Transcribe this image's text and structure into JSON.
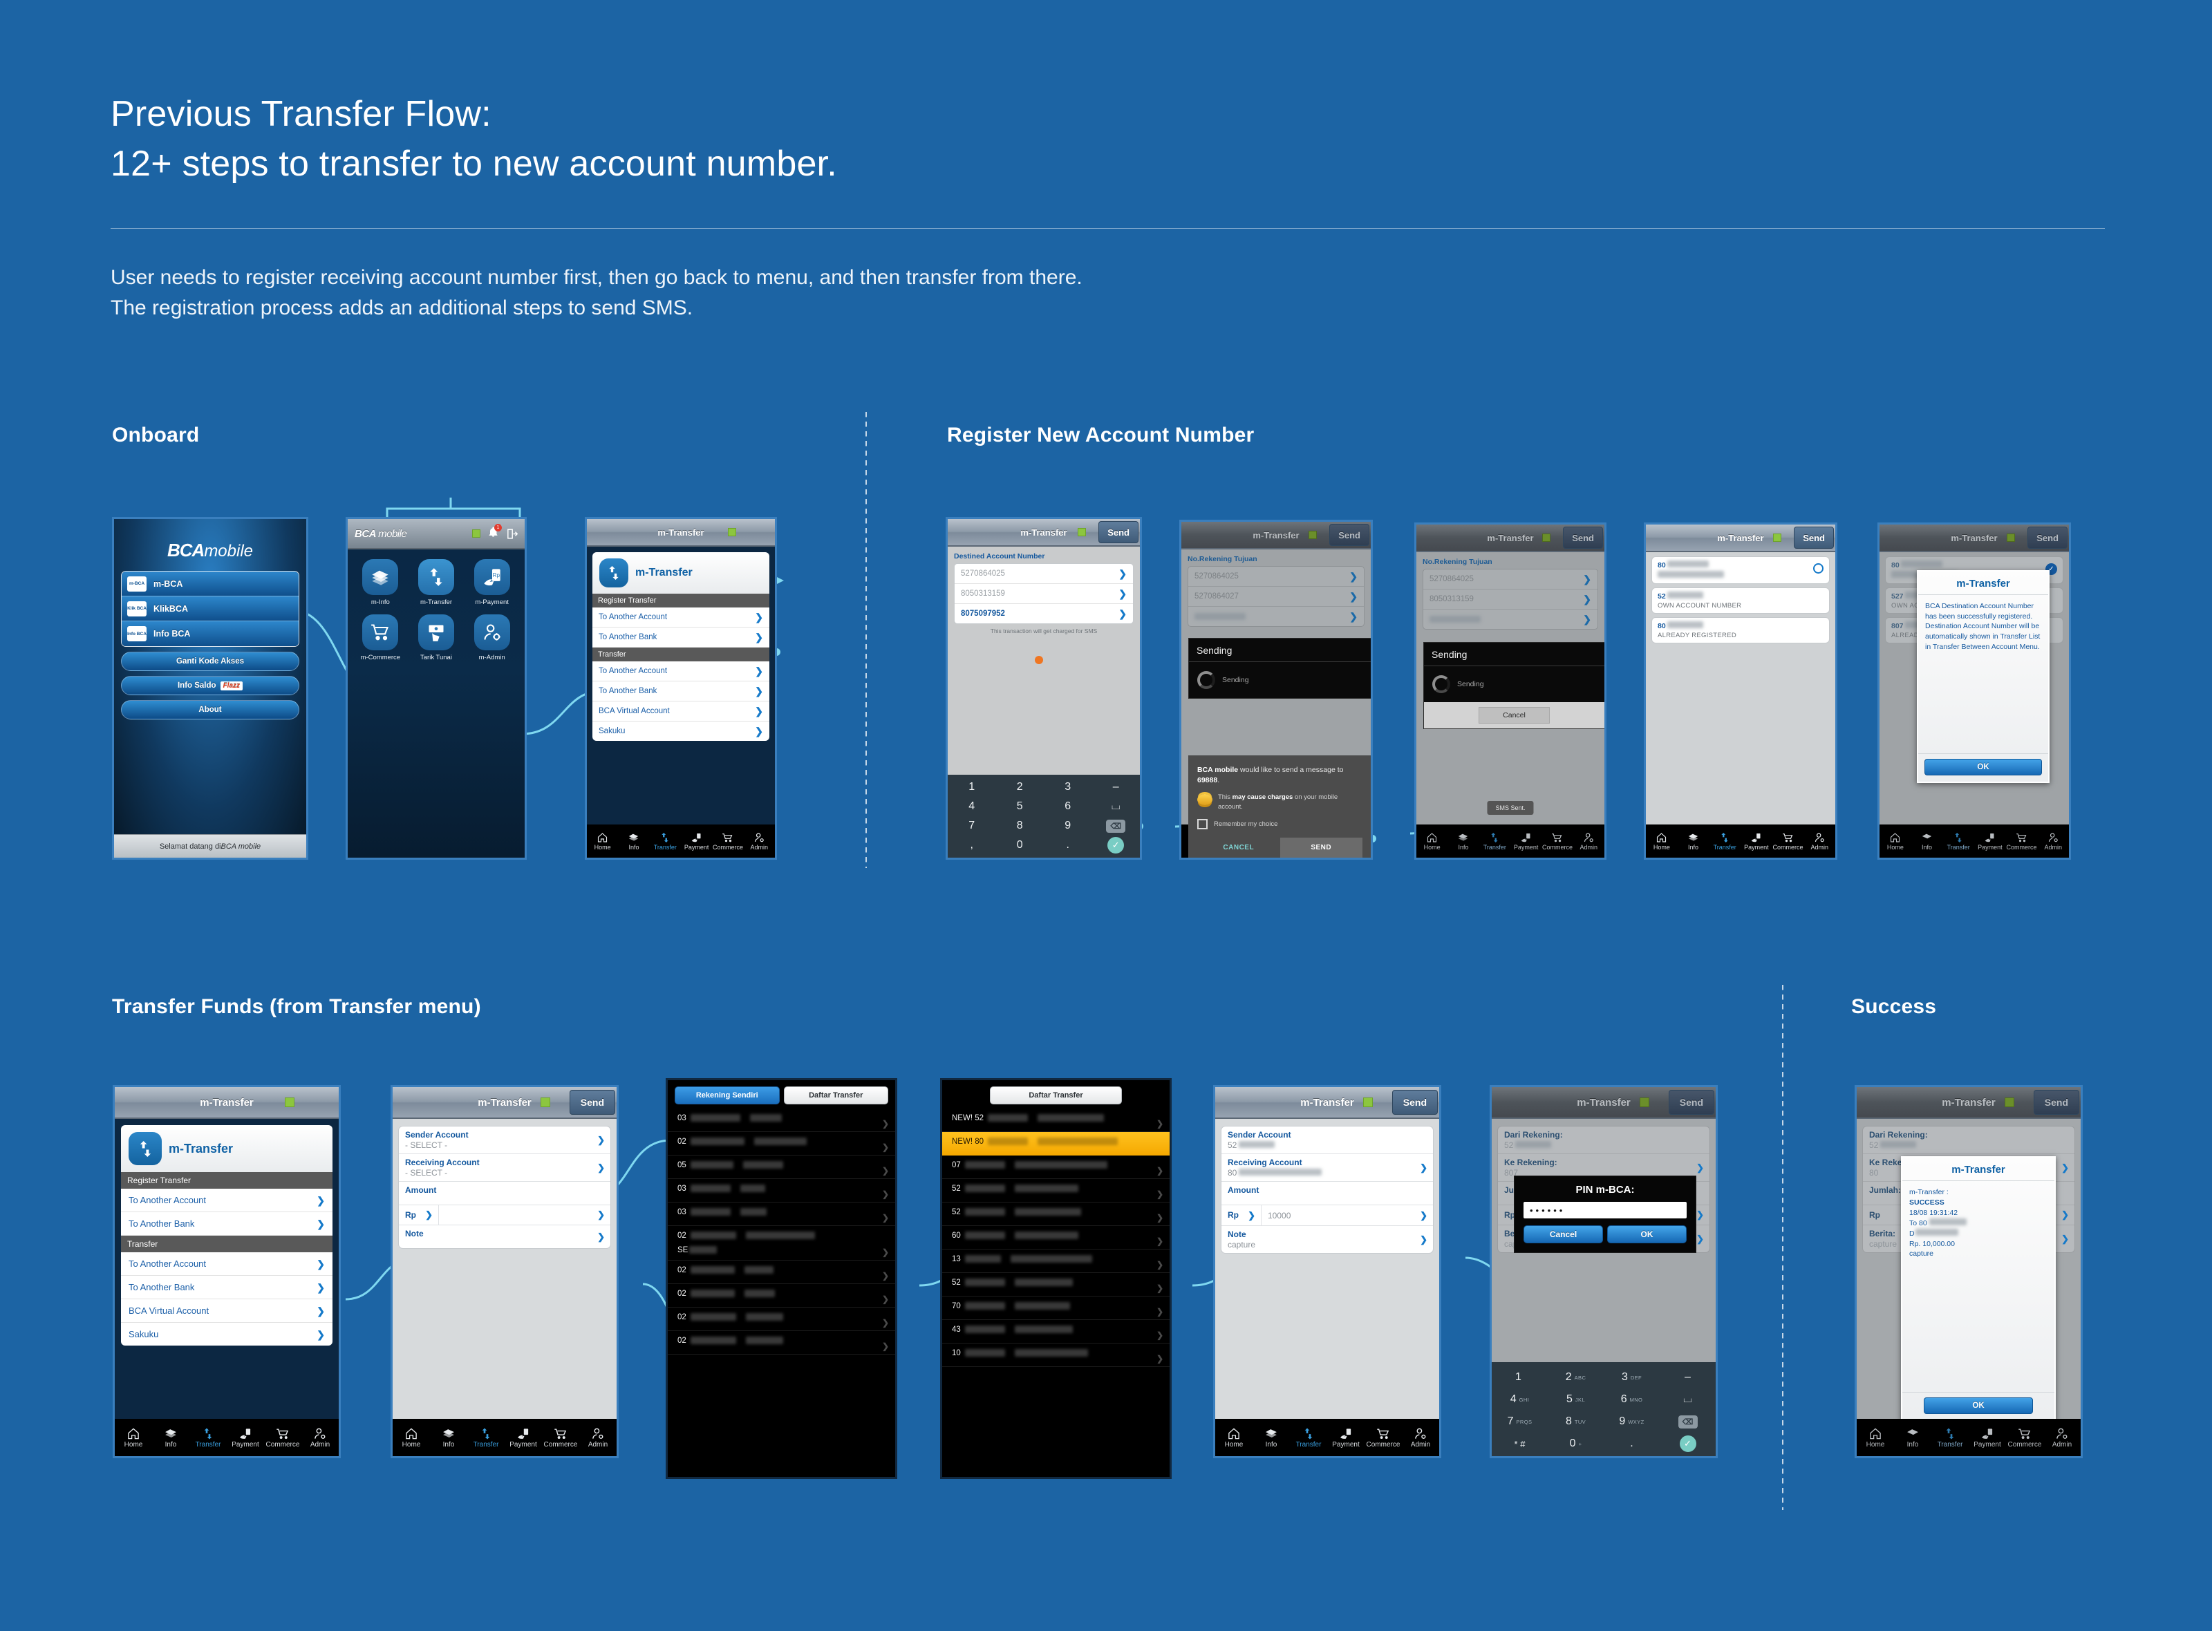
{
  "header": {
    "title_line1": "Previous Transfer Flow:",
    "title_line2": "12+ steps to transfer to new account number.",
    "sub_line1": "User needs to register receiving account number first, then go back to menu, and then transfer from there.",
    "sub_line2": "The registration process adds an additional steps to send SMS."
  },
  "sections": {
    "onboard": "Onboard",
    "register": "Register New Account Number",
    "transfer": "Transfer Funds (from Transfer menu)",
    "success": "Success"
  },
  "common": {
    "app_title": "m-Transfer",
    "send_label": "Send",
    "tabbar": [
      "Home",
      "Info",
      "Transfer",
      "Payment",
      "Commerce",
      "Admin"
    ]
  },
  "screen_login": {
    "brand_bold": "BCA",
    "brand_light": "mobile",
    "items": [
      {
        "label": "m-BCA",
        "tile": "m-BCA"
      },
      {
        "label": "KlikBCA",
        "tile": "Klik BCA"
      },
      {
        "label": "Info BCA",
        "tile": "Info BCA"
      }
    ],
    "buttons": [
      "Ganti Kode Akses",
      "Info Saldo",
      "About"
    ],
    "flazz_label": "Flazz",
    "welcome_plain": "Selamat datang di ",
    "welcome_italic": "BCA mobile"
  },
  "screen_menu": {
    "brand_bold": "BCA",
    "brand_light": "mobile",
    "badge_count": "1",
    "tiles": [
      "m-Info",
      "m-Transfer",
      "m-Payment",
      "m-Commerce",
      "Tarik Tunai",
      "m-Admin"
    ]
  },
  "screen_mtransfer_menu": {
    "title": "m-Transfer",
    "card_title": "m-Transfer",
    "groups": [
      {
        "header": "Register Transfer",
        "items": [
          "To Another Account",
          "To Another Bank"
        ]
      },
      {
        "header": "Transfer",
        "items": [
          "To Another Account",
          "To Another Bank",
          "BCA Virtual Account",
          "Sakuku"
        ]
      }
    ]
  },
  "screen_register_input": {
    "field_label": "Destined Account Number",
    "accounts": [
      "5270864025",
      "8050313159",
      "8075097952"
    ],
    "hint": "This transaction will get charged for SMS",
    "keypad": [
      [
        "1",
        "2",
        "3",
        "–"
      ],
      [
        "4",
        "5",
        "6",
        "⌴"
      ],
      [
        "7",
        "8",
        "9",
        "⌫"
      ],
      [
        ",",
        "0",
        ".",
        "✓"
      ]
    ]
  },
  "screen_register_sms": {
    "field_label": "No.Rekening Tujuan",
    "accounts": [
      "5270864025",
      "5270864027"
    ],
    "sending_title": "Sending",
    "sending_text": "Sending",
    "sms_message_1": "BCA mobile",
    "sms_message_2": " would like to send a message to ",
    "sms_message_3": "69888",
    "sms_message_4": ".",
    "charge_1": "This ",
    "charge_2": "may cause charges",
    "charge_3": " on your mobile account.",
    "remember_label": "Remember my choice",
    "cancel_label": "CANCEL",
    "send_label": "SEND"
  },
  "screen_register_sending": {
    "field_label": "No.Rekening Tujuan",
    "accounts": [
      "5270864025",
      "8050313159"
    ],
    "sending_title": "Sending",
    "sending_text": "Sending",
    "cancel_label": "Cancel",
    "toast": "SMS Sent."
  },
  "screen_register_list": {
    "accounts": [
      {
        "prefix": "80",
        "desc": ""
      },
      {
        "prefix": "52",
        "desc": "OWN ACCOUNT NUMBER"
      },
      {
        "prefix": "80",
        "desc": "ALREADY REGISTERED"
      }
    ]
  },
  "screen_register_success": {
    "dialog_title": "m-Transfer",
    "dialog_body": "BCA Destination Account Number has been successfully registered. Destination Account Number will be automatically shown in Transfer List in Transfer Between Account Menu.",
    "ok_label": "OK"
  },
  "screen_transfer_form_empty": {
    "fields": [
      {
        "label": "Sender Account",
        "value": "- SELECT -"
      },
      {
        "label": "Receiving Account",
        "value": "- SELECT -"
      },
      {
        "label": "Amount",
        "value": ""
      }
    ],
    "currency_label": "Rp",
    "amount_value": "",
    "note_label": "Note",
    "note_value": ""
  },
  "screen_account_picker": {
    "tab_own": "Rekening Sendiri",
    "tab_list": "Daftar Transfer",
    "rows": [
      "03",
      "02",
      "05",
      "03",
      "03",
      "02\nSE",
      "02",
      "02",
      "02",
      "02"
    ]
  },
  "screen_transfer_picker": {
    "tab_list": "Daftar Transfer",
    "rows": [
      "NEW! 52",
      "NEW! 80",
      "07",
      "52",
      "52",
      "60",
      "13",
      "52",
      "70",
      "43",
      "10"
    ],
    "highlight_index": 1
  },
  "screen_transfer_form_filled": {
    "fields": [
      {
        "label": "Sender Account",
        "value": "52"
      },
      {
        "label": "Receiving Account",
        "value": "80"
      },
      {
        "label": "Amount",
        "value": ""
      }
    ],
    "currency_label": "Rp",
    "amount_value": "10000",
    "note_label": "Note",
    "note_value": "capture"
  },
  "screen_pin": {
    "fields": [
      {
        "label": "Dari Rekening:",
        "value": "52"
      },
      {
        "label": "Ke Rekening:",
        "value": "807"
      },
      {
        "label": "Jumlah:",
        "value": ""
      }
    ],
    "currency_label": "Rp",
    "note_label": "Berita:",
    "note_value": "capture",
    "pin_title": "PIN m-BCA:",
    "pin_value": "••••••",
    "cancel_label": "Cancel",
    "ok_label": "OK",
    "keypad": [
      [
        {
          "d": "1",
          "s": ""
        },
        {
          "d": "2",
          "s": "ABC"
        },
        {
          "d": "3",
          "s": "DEF"
        },
        {
          "d": "–",
          "s": ""
        }
      ],
      [
        {
          "d": "4",
          "s": "GHI"
        },
        {
          "d": "5",
          "s": "JKL"
        },
        {
          "d": "6",
          "s": "MNO"
        },
        {
          "d": "⌴",
          "s": ""
        }
      ],
      [
        {
          "d": "7",
          "s": "PRQS"
        },
        {
          "d": "8",
          "s": "TUV"
        },
        {
          "d": "9",
          "s": "WXYZ"
        },
        {
          "d": "⌫",
          "s": ""
        }
      ],
      [
        {
          "d": "* #",
          "s": ""
        },
        {
          "d": "0",
          "s": "+"
        },
        {
          "d": ".",
          "s": ""
        },
        {
          "d": "✓",
          "s": ""
        }
      ]
    ]
  },
  "screen_success": {
    "fields": [
      {
        "label": "Dari Rekening:",
        "value": "52"
      },
      {
        "label": "Ke Rekening:",
        "value": "80"
      },
      {
        "label": "Jumlah:",
        "value": ""
      }
    ],
    "currency_label": "Rp",
    "note_label": "Berita:",
    "note_value": "capture",
    "dialog_title": "m-Transfer",
    "receipt": {
      "line1": "m-Transfer :",
      "line2": "SUCCESS",
      "line3": "18/08 19:31:42",
      "line4": "To 80",
      "line5": "D",
      "line6": "Rp. 10,000.00",
      "line7": "capture"
    },
    "ok_label": "OK"
  },
  "colors": {
    "background": "#1c64a4",
    "accent_cyan": "#7fd8f0",
    "accent_orange": "#ef7622",
    "brand_blue": "#1062a5",
    "highlight_yellow": "#f5a800"
  }
}
